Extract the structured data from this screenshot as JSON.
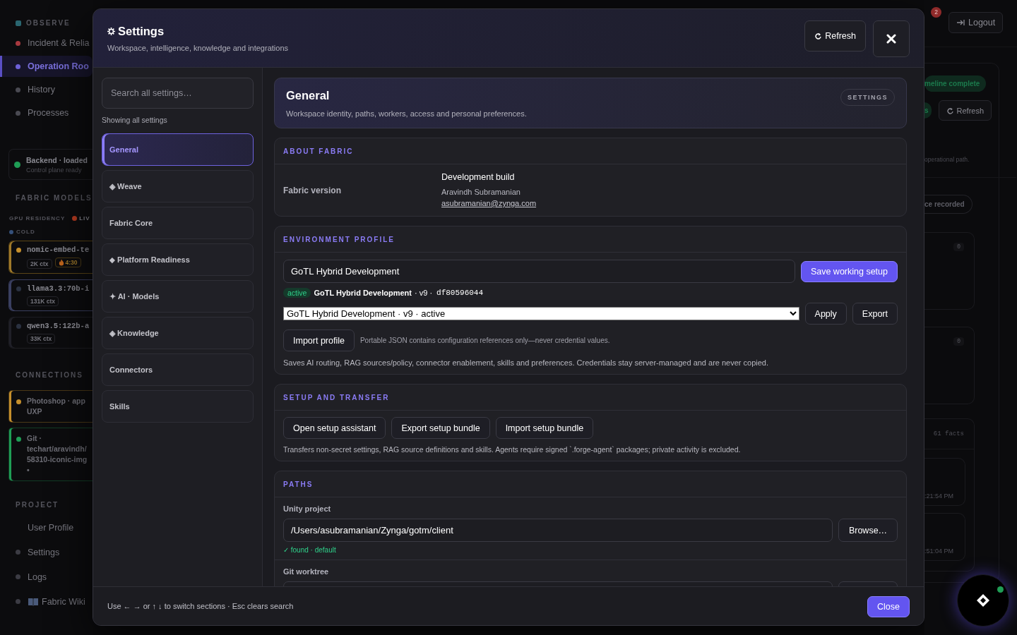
{
  "sidebar": {
    "observe": {
      "title": "OBSERVE",
      "items": [
        {
          "label": "Incident & Relia",
          "color": "#a8393f",
          "selected": false
        },
        {
          "label": "Operation Roo",
          "color": "#6d60d8",
          "selected": true
        },
        {
          "label": "History",
          "color": "#4a4a52",
          "selected": false
        },
        {
          "label": "Processes",
          "color": "#4a4a52",
          "selected": false
        }
      ]
    },
    "backend": {
      "title": "Backend · loaded",
      "subtitle": "Control plane ready",
      "color": "#1f9d55"
    },
    "fabric_models": {
      "title": "FABRIC MODELS",
      "gpu_residency": "GPU RESIDENCY",
      "live": "LIV",
      "cold": "COLD",
      "models": [
        {
          "name": "nomic-embed-te",
          "ctx": "2K ctx",
          "timer": "4:30",
          "kind": "warm",
          "color": "#c58f2c"
        },
        {
          "name": "llama3.3:70b-i",
          "ctx": "131K ctx",
          "kind": "loaded",
          "color": "#2a3140"
        },
        {
          "name": "qwen3.5:122b-a",
          "ctx": "33K ctx",
          "kind": "cold",
          "color": "#2a3140"
        }
      ]
    },
    "connections": {
      "title": "CONNECTIONS",
      "items": [
        {
          "lines": [
            "Photoshop · app",
            "UXP"
          ],
          "color": "#c58f2c"
        },
        {
          "lines": [
            "Git ·",
            "techart/aravindh/",
            "58310-iconic-img",
            "•"
          ],
          "color": "#1f9d55"
        }
      ]
    },
    "project": {
      "title": "PROJECT",
      "items": [
        {
          "label": "User Profile",
          "kind": "plain"
        },
        {
          "label": "Settings",
          "kind": "dot"
        },
        {
          "label": "Logs",
          "kind": "dot"
        },
        {
          "label": "Fabric Wiki",
          "kind": "book"
        }
      ]
    }
  },
  "topbar": {
    "notification_count": "2",
    "logout": "Logout"
  },
  "background_panel": {
    "status_pill": "meline complete",
    "green_pill": "s",
    "refresh": "Refresh",
    "note": "operational path.",
    "recorded_pill": "ce recorded",
    "counts": [
      "0",
      "0"
    ],
    "facts": "61 facts",
    "times": [
      ":21:54 PM",
      ":51:04 PM"
    ]
  },
  "settings": {
    "title": "Settings",
    "subtitle": "Workspace, intelligence, knowledge and integrations",
    "refresh": "Refresh",
    "search": {
      "placeholder": "Search all settings…"
    },
    "filter_status": "Showing all settings",
    "nav": [
      {
        "label": "General",
        "selected": true
      },
      {
        "label": "◈ Weave",
        "selected": false
      },
      {
        "label": "Fabric Core",
        "selected": false
      },
      {
        "label": "⬥ Platform Readiness",
        "selected": false
      },
      {
        "label": "✦ AI · Models",
        "selected": false
      },
      {
        "label": "◈ Knowledge",
        "selected": false
      },
      {
        "label": "Connectors",
        "selected": false
      },
      {
        "label": "Skills",
        "selected": false
      }
    ],
    "header": {
      "title": "General",
      "description": "Workspace identity, paths, workers, access and personal preferences.",
      "badge": "SETTINGS"
    },
    "about": {
      "title": "ABOUT FABRIC",
      "label": "Fabric version",
      "build": "Development build",
      "author": "Aravindh Subramanian",
      "email": "asubramanian@zynga.com"
    },
    "environment": {
      "title": "ENVIRONMENT PROFILE",
      "name_value": "GoTL Hybrid Development",
      "save": "Save working setup",
      "status": "active",
      "profile": "GoTL Hybrid Development",
      "version": "· v9 ·",
      "hash": "df80596044",
      "selected_profile": "GoTL Hybrid Development · v9 · active",
      "apply": "Apply",
      "export": "Export",
      "import": "Import profile",
      "import_note": "Portable JSON contains configuration references only—never credential values.",
      "note": "Saves AI routing, RAG sources/policy, connector enablement, skills and preferences. Credentials stay server-managed and are never copied."
    },
    "setup": {
      "title": "SETUP AND TRANSFER",
      "buttons": [
        "Open setup assistant",
        "Export setup bundle",
        "Import setup bundle"
      ],
      "note": "Transfers non-secret settings, RAG source definitions and skills. Agents require signed `.forge-agent` packages; private activity is excluded."
    },
    "paths": {
      "title": "PATHS",
      "fields": [
        {
          "label": "Unity project",
          "value": "/Users/asubramanian/Zynga/gotm/client",
          "browse": "Browse…",
          "status": "✓ found · default"
        },
        {
          "label": "Git worktree"
        }
      ]
    },
    "footer": {
      "hint": "Use ← → or ↑ ↓ to switch sections · Esc clears search",
      "close": "Close"
    }
  }
}
